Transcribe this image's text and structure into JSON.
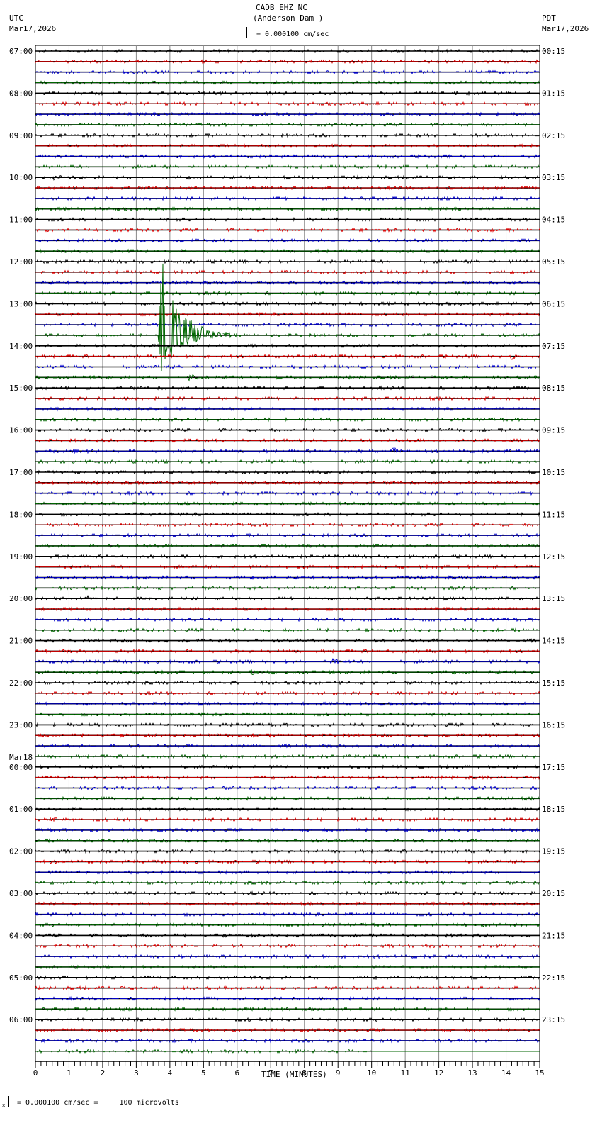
{
  "header": {
    "station": "CADB EHZ NC",
    "location": "(Anderson Dam )",
    "left_zone": "UTC",
    "left_date": "Mar17,2026",
    "right_zone": "PDT",
    "right_date": "Mar17,2026",
    "scale": "= 0.000100 cm/sec"
  },
  "footer": {
    "scale_note": "= 0.000100 cm/sec =     100 microvolts"
  },
  "chart_data": {
    "type": "line",
    "title": "CADB EHZ NC (Anderson Dam )",
    "xlabel": "TIME (MINUTES)",
    "xlim": [
      0,
      15
    ],
    "x_ticks": [
      "0",
      "1",
      "2",
      "3",
      "4",
      "5",
      "6",
      "7",
      "8",
      "9",
      "10",
      "11",
      "12",
      "13",
      "14",
      "15"
    ],
    "trace_count": 96,
    "trace_minutes": 15,
    "trace_colors": [
      "#000000",
      "#dd0000",
      "#0000cc",
      "#006600"
    ],
    "left_labels": [
      {
        "row": 0,
        "text": "07:00"
      },
      {
        "row": 4,
        "text": "08:00"
      },
      {
        "row": 8,
        "text": "09:00"
      },
      {
        "row": 12,
        "text": "10:00"
      },
      {
        "row": 16,
        "text": "11:00"
      },
      {
        "row": 20,
        "text": "12:00"
      },
      {
        "row": 24,
        "text": "13:00"
      },
      {
        "row": 28,
        "text": "14:00"
      },
      {
        "row": 32,
        "text": "15:00"
      },
      {
        "row": 36,
        "text": "16:00"
      },
      {
        "row": 40,
        "text": "17:00"
      },
      {
        "row": 44,
        "text": "18:00"
      },
      {
        "row": 48,
        "text": "19:00"
      },
      {
        "row": 52,
        "text": "20:00"
      },
      {
        "row": 56,
        "text": "21:00"
      },
      {
        "row": 60,
        "text": "22:00"
      },
      {
        "row": 64,
        "text": "23:00"
      },
      {
        "row": 68,
        "text": "00:00",
        "date": "Mar18"
      },
      {
        "row": 72,
        "text": "01:00"
      },
      {
        "row": 76,
        "text": "02:00"
      },
      {
        "row": 80,
        "text": "03:00"
      },
      {
        "row": 84,
        "text": "04:00"
      },
      {
        "row": 88,
        "text": "05:00"
      },
      {
        "row": 92,
        "text": "06:00"
      }
    ],
    "right_labels": [
      "00:15",
      "01:15",
      "02:15",
      "03:15",
      "04:15",
      "05:15",
      "06:15",
      "07:15",
      "08:15",
      "09:15",
      "10:15",
      "11:15",
      "12:15",
      "13:15",
      "14:15",
      "15:15",
      "16:15",
      "17:15",
      "18:15",
      "19:15",
      "20:15",
      "21:15",
      "22:15",
      "23:15"
    ],
    "events": [
      {
        "row": 12,
        "minute": 0.5,
        "amp_up": 4,
        "amp_down": 4,
        "duration": 0.5
      },
      {
        "row": 27,
        "minute": 3.65,
        "amp_up": 133,
        "amp_down": 68,
        "duration": 2.2
      },
      {
        "row": 29,
        "minute": 14.1,
        "amp_up": 9,
        "amp_down": 10,
        "duration": 0.5
      },
      {
        "row": 31,
        "minute": 4.5,
        "amp_up": 7,
        "amp_down": 7,
        "duration": 0.7
      },
      {
        "row": 38,
        "minute": 1.1,
        "amp_up": 7,
        "amp_down": 5,
        "duration": 0.8
      },
      {
        "row": 38,
        "minute": 10.6,
        "amp_up": 9,
        "amp_down": 5,
        "duration": 0.7
      },
      {
        "row": 52,
        "minute": 1.4,
        "amp_up": 3,
        "amp_down": 2,
        "duration": 1.4
      },
      {
        "row": 58,
        "minute": 8.8,
        "amp_up": 8,
        "amp_down": 8,
        "duration": 0.7
      },
      {
        "row": 59,
        "minute": 6.4,
        "amp_up": 6,
        "amp_down": 6,
        "duration": 0.8
      },
      {
        "row": 73,
        "minute": 0.4,
        "amp_up": 3,
        "amp_down": 3,
        "duration": 0.8
      },
      {
        "row": 94,
        "minute": 9.3,
        "amp_up": 3,
        "amp_down": 2,
        "duration": 0.4
      }
    ],
    "end_of_data": {
      "row": 95,
      "minute": 10
    }
  }
}
